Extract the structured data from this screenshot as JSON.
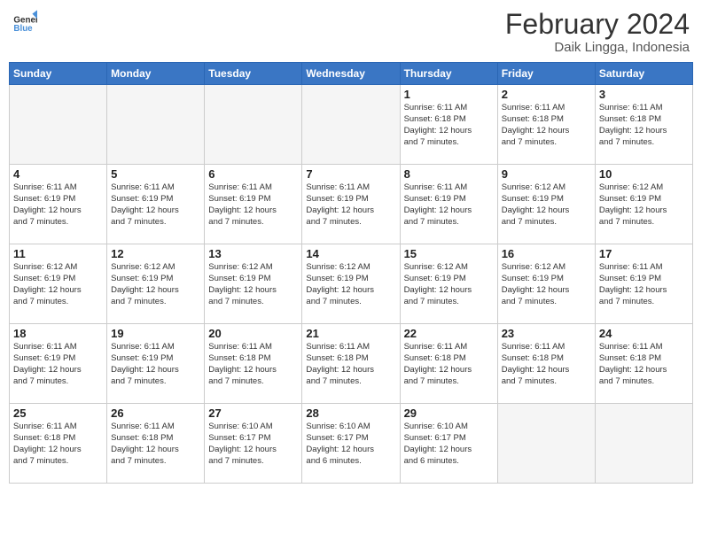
{
  "header": {
    "logo_line1": "General",
    "logo_line2": "Blue",
    "month_title": "February 2024",
    "location": "Daik Lingga, Indonesia"
  },
  "days_of_week": [
    "Sunday",
    "Monday",
    "Tuesday",
    "Wednesday",
    "Thursday",
    "Friday",
    "Saturday"
  ],
  "weeks": [
    [
      {
        "day": "",
        "info": ""
      },
      {
        "day": "",
        "info": ""
      },
      {
        "day": "",
        "info": ""
      },
      {
        "day": "",
        "info": ""
      },
      {
        "day": "1",
        "info": "Sunrise: 6:11 AM\nSunset: 6:18 PM\nDaylight: 12 hours\nand 7 minutes."
      },
      {
        "day": "2",
        "info": "Sunrise: 6:11 AM\nSunset: 6:18 PM\nDaylight: 12 hours\nand 7 minutes."
      },
      {
        "day": "3",
        "info": "Sunrise: 6:11 AM\nSunset: 6:18 PM\nDaylight: 12 hours\nand 7 minutes."
      }
    ],
    [
      {
        "day": "4",
        "info": "Sunrise: 6:11 AM\nSunset: 6:19 PM\nDaylight: 12 hours\nand 7 minutes."
      },
      {
        "day": "5",
        "info": "Sunrise: 6:11 AM\nSunset: 6:19 PM\nDaylight: 12 hours\nand 7 minutes."
      },
      {
        "day": "6",
        "info": "Sunrise: 6:11 AM\nSunset: 6:19 PM\nDaylight: 12 hours\nand 7 minutes."
      },
      {
        "day": "7",
        "info": "Sunrise: 6:11 AM\nSunset: 6:19 PM\nDaylight: 12 hours\nand 7 minutes."
      },
      {
        "day": "8",
        "info": "Sunrise: 6:11 AM\nSunset: 6:19 PM\nDaylight: 12 hours\nand 7 minutes."
      },
      {
        "day": "9",
        "info": "Sunrise: 6:12 AM\nSunset: 6:19 PM\nDaylight: 12 hours\nand 7 minutes."
      },
      {
        "day": "10",
        "info": "Sunrise: 6:12 AM\nSunset: 6:19 PM\nDaylight: 12 hours\nand 7 minutes."
      }
    ],
    [
      {
        "day": "11",
        "info": "Sunrise: 6:12 AM\nSunset: 6:19 PM\nDaylight: 12 hours\nand 7 minutes."
      },
      {
        "day": "12",
        "info": "Sunrise: 6:12 AM\nSunset: 6:19 PM\nDaylight: 12 hours\nand 7 minutes."
      },
      {
        "day": "13",
        "info": "Sunrise: 6:12 AM\nSunset: 6:19 PM\nDaylight: 12 hours\nand 7 minutes."
      },
      {
        "day": "14",
        "info": "Sunrise: 6:12 AM\nSunset: 6:19 PM\nDaylight: 12 hours\nand 7 minutes."
      },
      {
        "day": "15",
        "info": "Sunrise: 6:12 AM\nSunset: 6:19 PM\nDaylight: 12 hours\nand 7 minutes."
      },
      {
        "day": "16",
        "info": "Sunrise: 6:12 AM\nSunset: 6:19 PM\nDaylight: 12 hours\nand 7 minutes."
      },
      {
        "day": "17",
        "info": "Sunrise: 6:11 AM\nSunset: 6:19 PM\nDaylight: 12 hours\nand 7 minutes."
      }
    ],
    [
      {
        "day": "18",
        "info": "Sunrise: 6:11 AM\nSunset: 6:19 PM\nDaylight: 12 hours\nand 7 minutes."
      },
      {
        "day": "19",
        "info": "Sunrise: 6:11 AM\nSunset: 6:19 PM\nDaylight: 12 hours\nand 7 minutes."
      },
      {
        "day": "20",
        "info": "Sunrise: 6:11 AM\nSunset: 6:18 PM\nDaylight: 12 hours\nand 7 minutes."
      },
      {
        "day": "21",
        "info": "Sunrise: 6:11 AM\nSunset: 6:18 PM\nDaylight: 12 hours\nand 7 minutes."
      },
      {
        "day": "22",
        "info": "Sunrise: 6:11 AM\nSunset: 6:18 PM\nDaylight: 12 hours\nand 7 minutes."
      },
      {
        "day": "23",
        "info": "Sunrise: 6:11 AM\nSunset: 6:18 PM\nDaylight: 12 hours\nand 7 minutes."
      },
      {
        "day": "24",
        "info": "Sunrise: 6:11 AM\nSunset: 6:18 PM\nDaylight: 12 hours\nand 7 minutes."
      }
    ],
    [
      {
        "day": "25",
        "info": "Sunrise: 6:11 AM\nSunset: 6:18 PM\nDaylight: 12 hours\nand 7 minutes."
      },
      {
        "day": "26",
        "info": "Sunrise: 6:11 AM\nSunset: 6:18 PM\nDaylight: 12 hours\nand 7 minutes."
      },
      {
        "day": "27",
        "info": "Sunrise: 6:10 AM\nSunset: 6:17 PM\nDaylight: 12 hours\nand 7 minutes."
      },
      {
        "day": "28",
        "info": "Sunrise: 6:10 AM\nSunset: 6:17 PM\nDaylight: 12 hours\nand 6 minutes."
      },
      {
        "day": "29",
        "info": "Sunrise: 6:10 AM\nSunset: 6:17 PM\nDaylight: 12 hours\nand 6 minutes."
      },
      {
        "day": "",
        "info": ""
      },
      {
        "day": "",
        "info": ""
      }
    ]
  ]
}
